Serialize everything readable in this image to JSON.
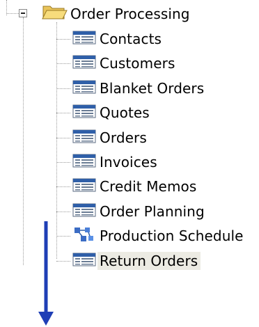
{
  "tree": {
    "root": {
      "label": "Order Processing",
      "expander_state": "expanded",
      "icon": "folder-open-icon"
    },
    "items": [
      {
        "label": "Contacts",
        "icon": "table-icon",
        "selected": false
      },
      {
        "label": "Customers",
        "icon": "table-icon",
        "selected": false
      },
      {
        "label": "Blanket Orders",
        "icon": "table-icon",
        "selected": false
      },
      {
        "label": "Quotes",
        "icon": "table-icon",
        "selected": false
      },
      {
        "label": "Orders",
        "icon": "table-icon",
        "selected": false
      },
      {
        "label": "Invoices",
        "icon": "table-icon",
        "selected": false
      },
      {
        "label": "Credit Memos",
        "icon": "table-icon",
        "selected": false
      },
      {
        "label": "Order Planning",
        "icon": "table-icon",
        "selected": false
      },
      {
        "label": "Production Schedule",
        "icon": "network-icon",
        "selected": false
      },
      {
        "label": "Return Orders",
        "icon": "table-icon",
        "selected": true
      }
    ]
  },
  "colors": {
    "folder": "#f2c94c",
    "table_icon_header": "#2f5fa8",
    "selection": "#ecebe3",
    "arrow": "#1f3fb6"
  }
}
